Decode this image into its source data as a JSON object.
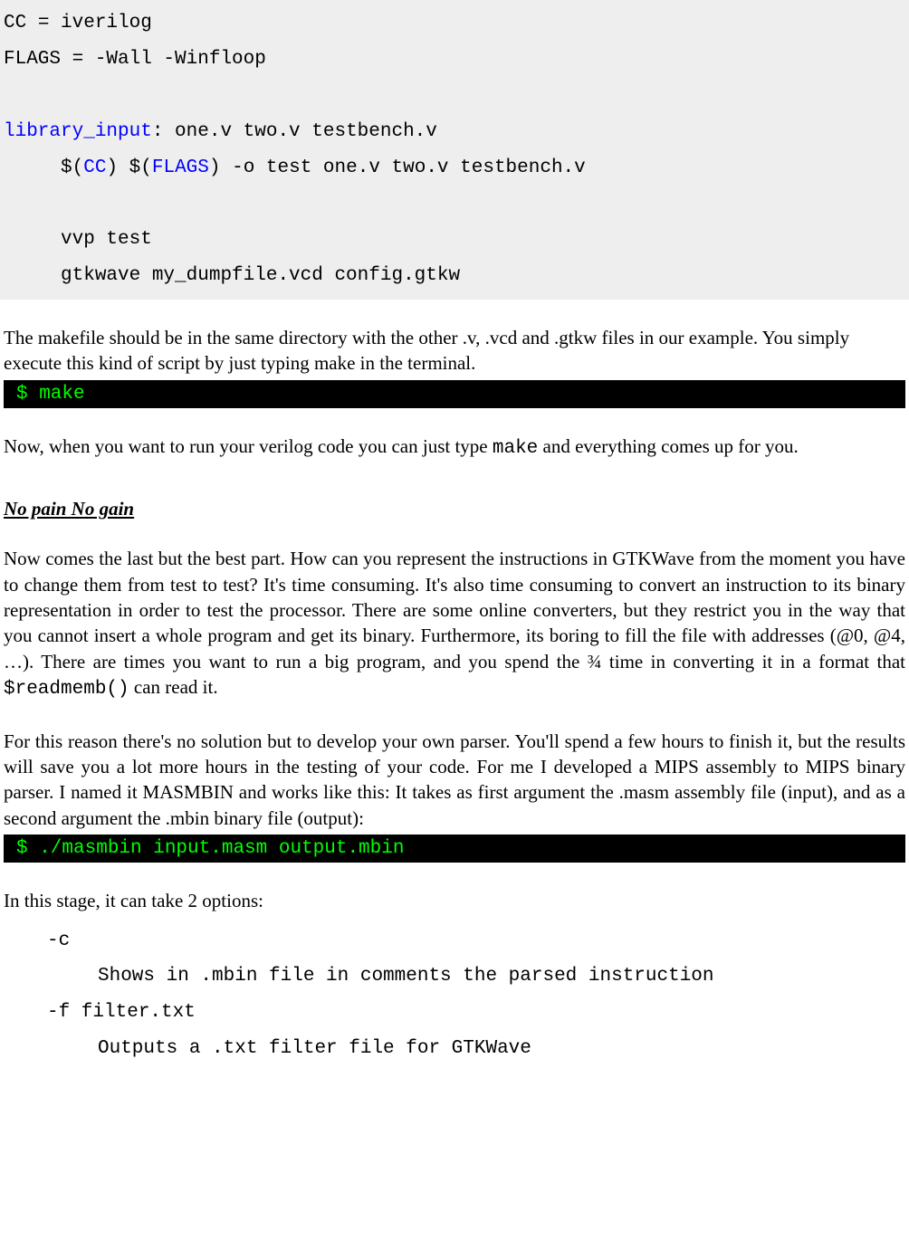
{
  "makefile": {
    "cc_label": "CC",
    "cc_value": " = iverilog",
    "flags_label": "FLAGS",
    "flags_value": " = -Wall -Winfloop",
    "blank1": " ",
    "target": "library_input",
    "deps": ": one.v two.v testbench.v",
    "indent": "     ",
    "dollar1": "$(",
    "cc_ref": "CC",
    "mid1": ") $(",
    "flags_ref": "FLAGS",
    "rest1": ") -o test one.v two.v testbench.v",
    "blank2": " ",
    "vvp": "     vvp test",
    "gtkwave": "     gtkwave my_dumpfile.vcd config.gtkw"
  },
  "para1": "The makefile should be in the same directory with the other .v, .vcd and .gtkw files in our example. You simply execute this kind of script by just typing make in the terminal.",
  "term1": "$ make",
  "para2_a": "Now, when you want to run your verilog code you can just type ",
  "para2_make": "make",
  "para2_b": " and everything comes up for you.",
  "heading": "No pain No gain",
  "para3_a": "Now comes the last but the best part. How can you represent the instructions in GTKWave from the moment you have to change them from test to test? It's time consuming. It's also time consuming to convert an instruction to its binary representation in order to test the processor. There are some online converters, but they restrict you in the way that you cannot insert a whole program and get its binary. Furthermore, its boring to fill the file with addresses (@0, @4, …). There are times you want to run a big program, and you spend the ¾ time in converting it in a format that ",
  "para3_read": "$readmemb()",
  "para3_b": " can read it.",
  "para4": "For this reason there's no solution but to develop your own parser. You'll spend a few hours to finish it, but the results will save you a lot more hours in the testing of your code. For me I developed a MIPS assembly to MIPS binary parser. I named it MASMBIN and works like this: It takes as first argument the .masm assembly file (input), and as a second argument the .mbin binary file (output):",
  "term2": "$ ./masmbin input.masm output.mbin",
  "para5": "In this stage, it can take 2 options:",
  "options": {
    "opt1_name": "-c",
    "opt1_desc": "Shows in .mbin file in comments the parsed instruction",
    "opt2_name": "-f filter.txt",
    "opt2_desc": "Outputs a .txt filter file for GTKWave"
  }
}
